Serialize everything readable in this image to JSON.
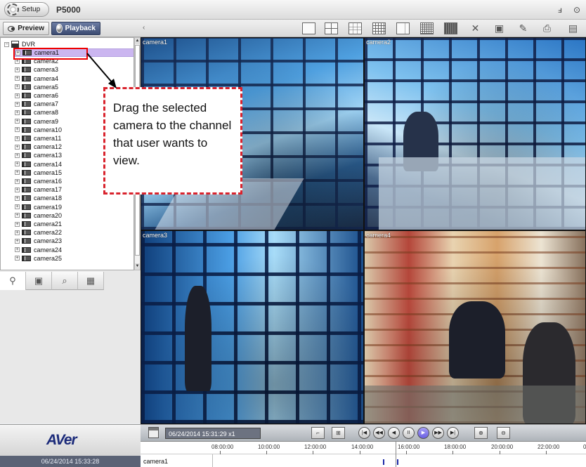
{
  "titlebar": {
    "setup_label": "Setup",
    "app_title": "P5000",
    "minimize_glyph": "ⅎ",
    "close_glyph": "⊙"
  },
  "modebar": {
    "preview_label": "Preview",
    "playback_label": "Playback",
    "collapse_glyph": "‹"
  },
  "tree": {
    "root_label": "DVR",
    "cameras": [
      "camera1",
      "camera2",
      "camera3",
      "camera4",
      "camera5",
      "camera6",
      "camera7",
      "camera8",
      "camera9",
      "camera10",
      "camera11",
      "camera12",
      "camera13",
      "camera14",
      "camera15",
      "camera16",
      "camera17",
      "camera18",
      "camera19",
      "camera20",
      "camera21",
      "camera22",
      "camera23",
      "camera24",
      "camera25"
    ],
    "selected": "camera1"
  },
  "video": {
    "cells": [
      {
        "label": "camera1"
      },
      {
        "label": "camera2"
      },
      {
        "label": "camera3"
      },
      {
        "label": "camera4"
      }
    ]
  },
  "callout": {
    "text": "Drag the selected camera to the channel that user wants to view."
  },
  "bottom": {
    "logo": "AVer",
    "clock": "06/24/2014 15:33:28",
    "time_field": "06/24/2014 15:31:29 x1",
    "timeline": {
      "ticks": [
        "08:00:00",
        "10:00:00",
        "12:00:00",
        "14:00:00",
        "16:00:00",
        "18:00:00",
        "20:00:00",
        "22:00:00",
        "0"
      ],
      "track_label": "camera1"
    }
  },
  "colors": {
    "selection": "#cbb6f0",
    "callout_border": "#d9232d",
    "play_button": "#6a5fe3",
    "logo": "#1c2b7a"
  },
  "icons": [
    "gear-icon",
    "eye-icon",
    "film-reel-icon",
    "layout-1x1-icon",
    "layout-2x2-icon",
    "layout-3x3-icon",
    "layout-4x4-icon",
    "layout-custom-icon",
    "layout-5x5-icon",
    "layout-6x6-icon",
    "fullscreen-icon",
    "snapshot-icon",
    "edit-icon",
    "print-icon",
    "storage-icon",
    "calendar-icon"
  ]
}
